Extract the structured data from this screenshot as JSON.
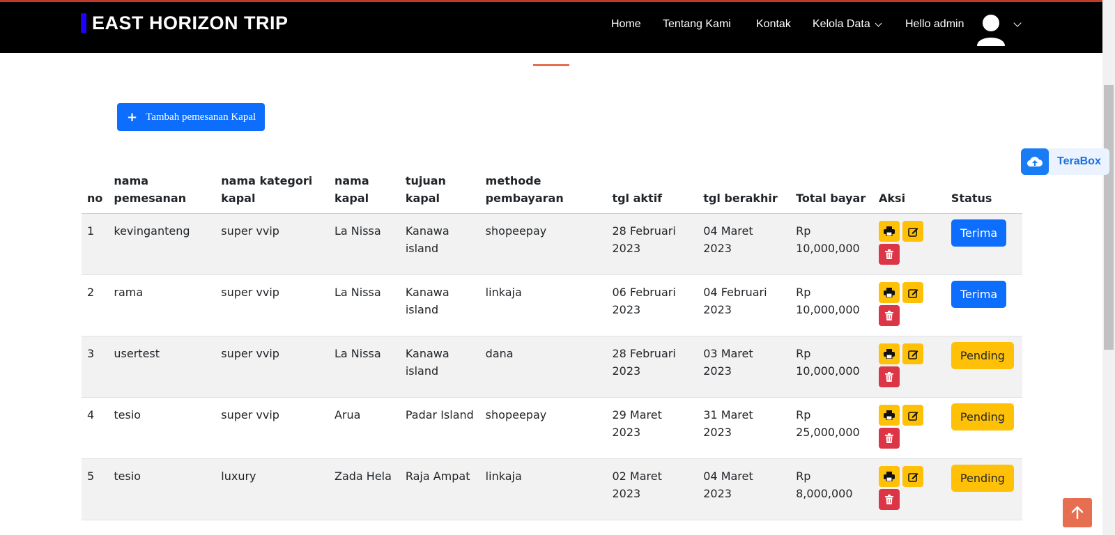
{
  "brand": {
    "name": "EAST HORIZON TRIP",
    "accent": "#1d00ff"
  },
  "nav": {
    "home": "Home",
    "about": "Tentang Kami",
    "contact": "Kontak",
    "manage": "Kelola Data",
    "greeting": "Hello admin"
  },
  "add_button": {
    "label": "Tambah pemesanan Kapal",
    "icon": "plus-icon"
  },
  "terabox": {
    "label": "TeraBox"
  },
  "table": {
    "headers": {
      "no": "no",
      "customer": "nama pemesanan",
      "category": "nama kategori kapal",
      "ship": "nama kapal",
      "destination": "tujuan kapal",
      "payment": "methode pembayaran",
      "start": "tgl aktif",
      "end": "tgl berakhir",
      "total": "Total bayar",
      "actions": "Aksi",
      "status": "Status"
    },
    "rows": [
      {
        "no": "1",
        "customer": "kevinganteng",
        "category": "super vvip",
        "ship": "La Nissa",
        "destination": "Kanawa island",
        "payment": "shopeepay",
        "start": "28 Februari 2023",
        "end": "04 Maret 2023",
        "total": "Rp 10,000,000",
        "status": "Terima"
      },
      {
        "no": "2",
        "customer": "rama",
        "category": "super vvip",
        "ship": "La Nissa",
        "destination": "Kanawa island",
        "payment": "linkaja",
        "start": "06 Februari 2023",
        "end": "04 Februari 2023",
        "total": "Rp 10,000,000",
        "status": "Terima"
      },
      {
        "no": "3",
        "customer": "usertest",
        "category": "super vvip",
        "ship": "La Nissa",
        "destination": "Kanawa island",
        "payment": "dana",
        "start": "28 Februari 2023",
        "end": "03 Maret 2023",
        "total": "Rp 10,000,000",
        "status": "Pending"
      },
      {
        "no": "4",
        "customer": "tesio",
        "category": "super vvip",
        "ship": "Arua",
        "destination": "Padar Island",
        "payment": "shopeepay",
        "start": "29 Maret 2023",
        "end": "31 Maret 2023",
        "total": "Rp 25,000,000",
        "status": "Pending"
      },
      {
        "no": "5",
        "customer": "tesio",
        "category": "luxury",
        "ship": "Zada Hela",
        "destination": "Raja Ampat",
        "payment": "linkaja",
        "start": "02 Maret 2023",
        "end": "04 Maret 2023",
        "total": "Rp 8,000,000",
        "status": "Pending"
      }
    ]
  },
  "colors": {
    "primary": "#0d6efd",
    "warning": "#ffc107",
    "danger": "#dc3545",
    "accent": "#e76f51"
  },
  "icons": {
    "print": "print-icon",
    "edit": "edit-icon",
    "delete": "trash-icon",
    "scroll_top": "arrow-up-icon",
    "user": "user-icon"
  }
}
